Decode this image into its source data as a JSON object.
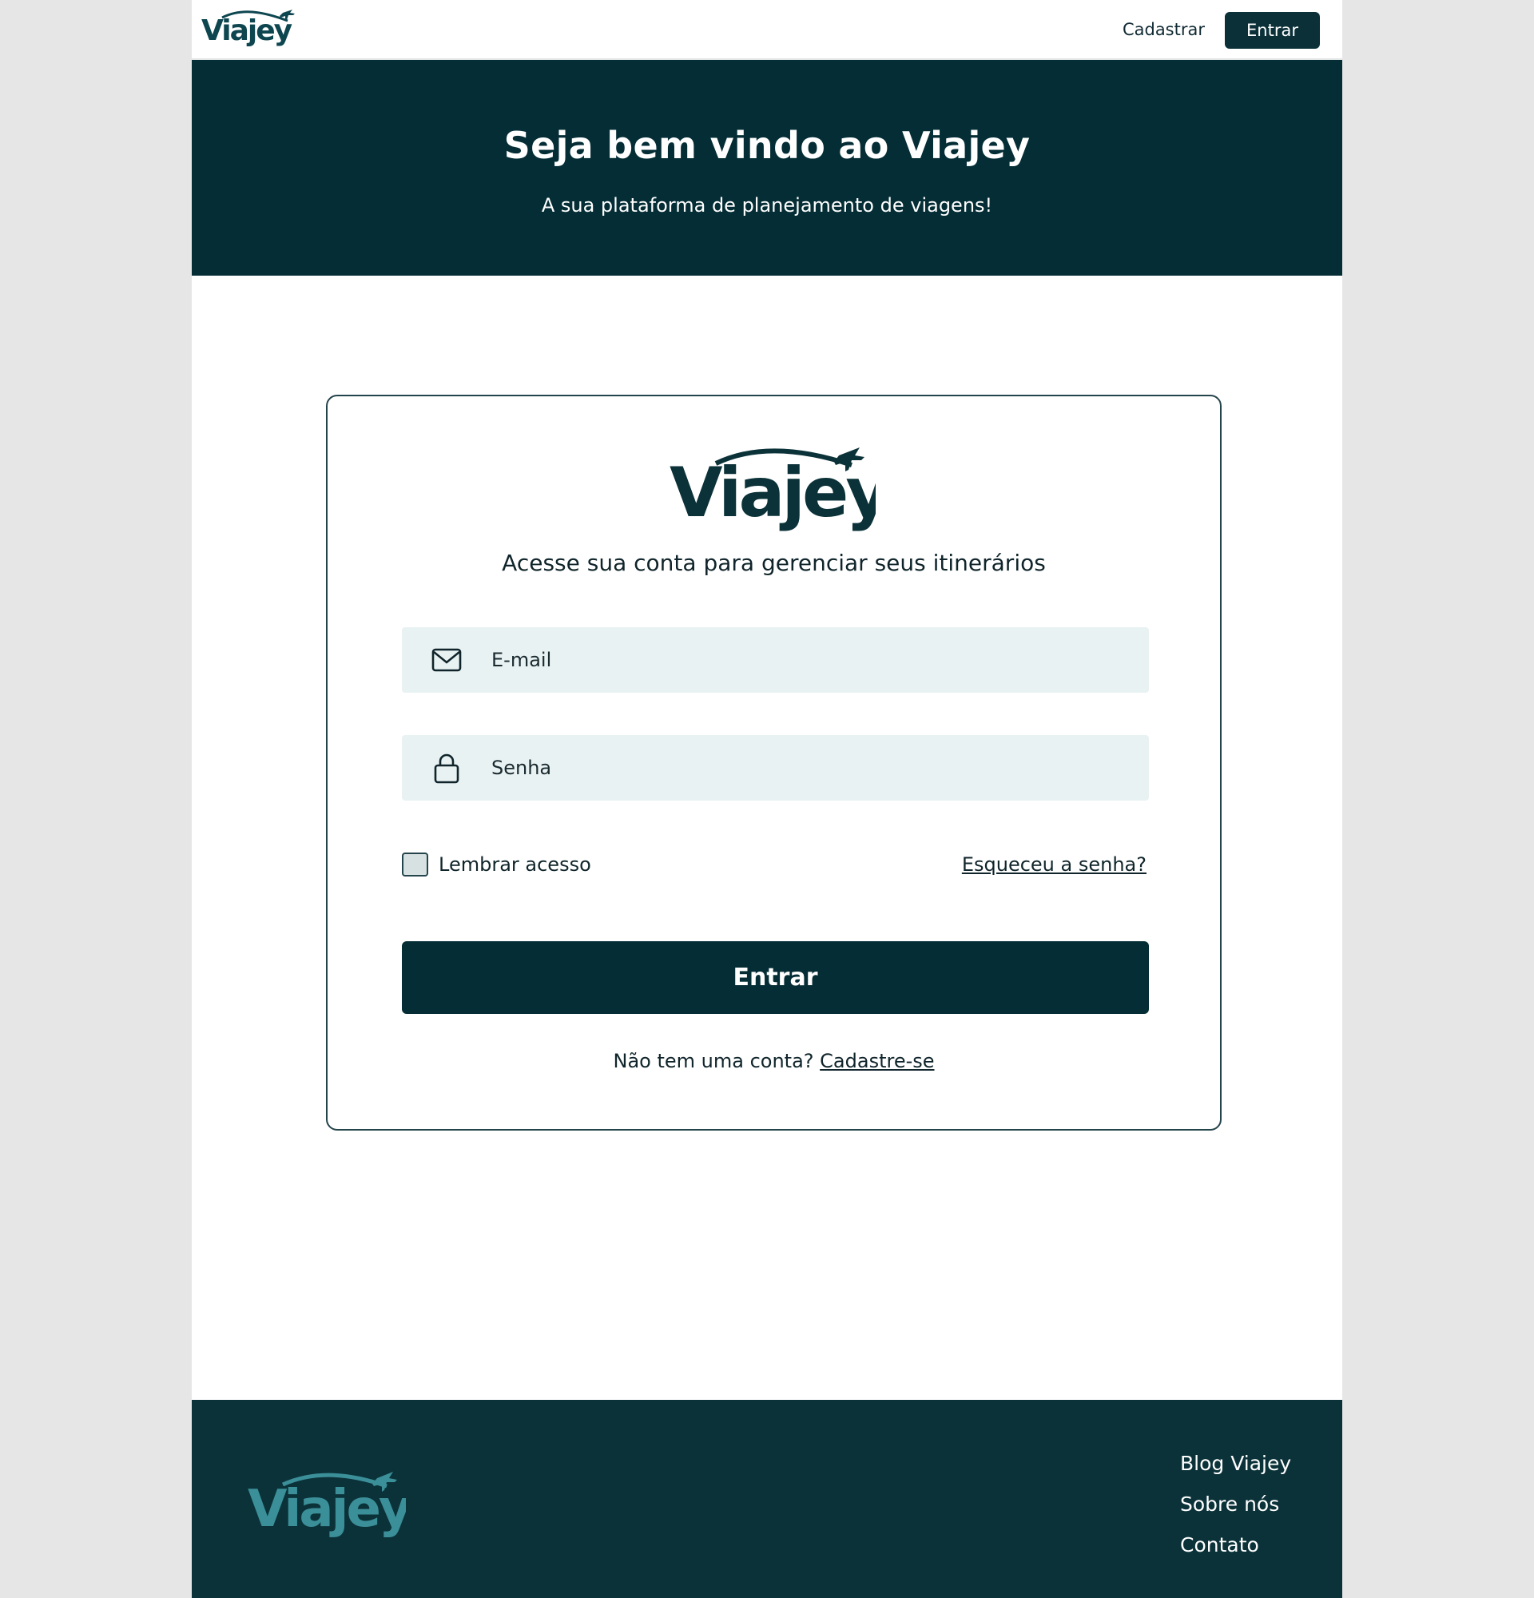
{
  "brand": {
    "name": "Viajey"
  },
  "nav": {
    "register_label": "Cadastrar",
    "login_label": "Entrar"
  },
  "hero": {
    "title": "Seja bem vindo ao Viajey",
    "subtitle": "A sua plataforma de planejamento de viagens!"
  },
  "login_card": {
    "tagline": "Acesse sua conta para gerenciar seus itinerários",
    "email": {
      "placeholder": "E-mail",
      "value": "",
      "icon": "mail-icon"
    },
    "password": {
      "placeholder": "Senha",
      "value": "",
      "icon": "lock-icon"
    },
    "remember": {
      "label": "Lembrar acesso",
      "checked": false
    },
    "forgot_label": "Esqueceu a senha?",
    "submit_label": "Entrar",
    "signup_prompt": "Não tem uma conta?",
    "signup_link": "Cadastre-se"
  },
  "footer": {
    "links": [
      "Blog Viajey",
      "Sobre nós",
      "Contato"
    ]
  },
  "colors": {
    "primary": "#042d35",
    "footer_bg": "#0b3239",
    "footer_logo": "#3b8f99",
    "input_bg": "#e9f2f3",
    "page_bg": "#e6e6e6"
  }
}
